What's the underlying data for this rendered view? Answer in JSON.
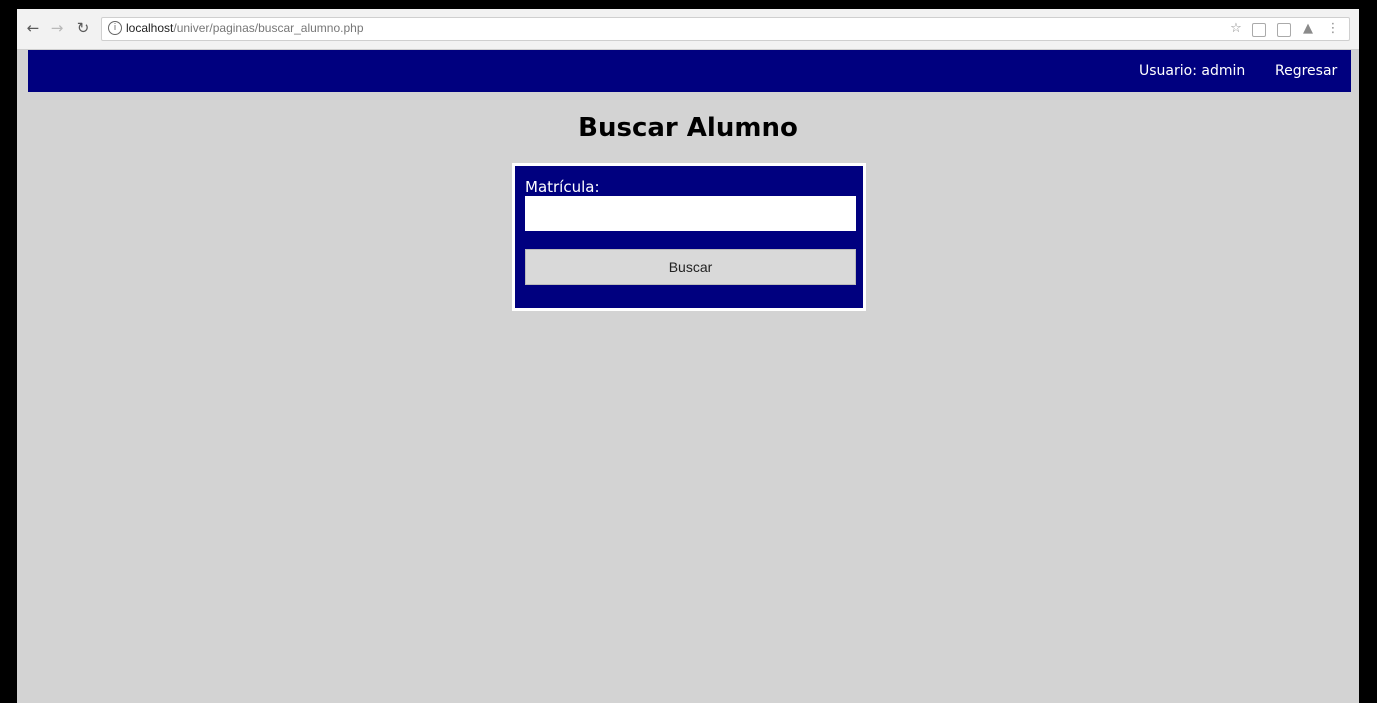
{
  "browser": {
    "url_host": "localhost",
    "url_path": "/univer/paginas/buscar_alumno.php",
    "nav_icons": [
      "back-arrow-icon",
      "forward-arrow-icon",
      "reload-icon"
    ],
    "toolbar_icons": [
      "bookmark-star-icon",
      "extension-icon",
      "extension-icon",
      "drive-icon",
      "menu-icon"
    ]
  },
  "header": {
    "user_label": "Usuario: admin",
    "back_link": "Regresar",
    "background": "#00007f"
  },
  "page": {
    "title": "Buscar Alumno",
    "background": "#d3d3d3"
  },
  "form": {
    "field_label": "Matrícula:",
    "field_value": "",
    "button_label": "Buscar",
    "box_color": "#00007f"
  }
}
